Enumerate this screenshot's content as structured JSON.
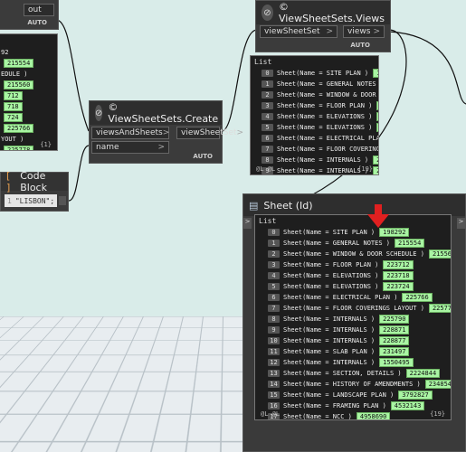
{
  "top_left_node": {
    "out_label": "out",
    "auto_label": "AUTO",
    "list_values": [
      "92",
      "215554",
      "EDULE )",
      "215560",
      "712",
      "718",
      "724",
      "225766",
      "YOUT )",
      "225778",
      "990"
    ],
    "count": "{1}"
  },
  "views_node": {
    "title": "© ViewSheetSets.Views",
    "input": "viewSheetSet",
    "output": "views",
    "auto_label": "AUTO",
    "list_header": "List",
    "count": "{19}",
    "footer_left": "@L @L",
    "rows": [
      {
        "index": "0",
        "text": "Sheet(Name = SITE PLAN )",
        "id": "19829"
      },
      {
        "index": "1",
        "text": "Sheet(Name = GENERAL NOTES )",
        "id": "2"
      },
      {
        "index": "2",
        "text": "Sheet(Name = WINDOW & DOOR SCHEI",
        "id": ""
      },
      {
        "index": "3",
        "text": "Sheet(Name = FLOOR PLAN )",
        "id": "2237"
      },
      {
        "index": "4",
        "text": "Sheet(Name = ELEVATIONS )",
        "id": "2237"
      },
      {
        "index": "5",
        "text": "Sheet(Name = ELEVATIONS )",
        "id": "2237"
      },
      {
        "index": "6",
        "text": "Sheet(Name = ELECTRICAL PLAN )",
        "id": ""
      },
      {
        "index": "7",
        "text": "Sheet(Name = FLOOR COVERINGS LA",
        "id": ""
      },
      {
        "index": "8",
        "text": "Sheet(Name = INTERNALS )",
        "id": "22579"
      },
      {
        "index": "9",
        "text": "Sheet(Name = INTERNALS )",
        "id": "22587"
      }
    ]
  },
  "create_node": {
    "title": "© ViewSheetSets.Create",
    "input1": "viewsAndSheets",
    "input2": "name",
    "output": "viewSheetSet",
    "auto_label": "AUTO"
  },
  "code_block": {
    "title": "Code Block",
    "line_no": "1",
    "code": "\"LISBON\";"
  },
  "sheet_node": {
    "title": "Sheet (Id)",
    "list_header": "List",
    "count": "{19}",
    "footer_left": "@L @L",
    "rows": [
      {
        "index": "0",
        "text": "Sheet(Name = SITE PLAN )",
        "id": "198292"
      },
      {
        "index": "1",
        "text": "Sheet(Name = GENERAL NOTES )",
        "id": "215554"
      },
      {
        "index": "2",
        "text": "Sheet(Name = WINDOW & DOOR SCHEDULE )",
        "id": "215560"
      },
      {
        "index": "3",
        "text": "Sheet(Name = FLOOR PLAN )",
        "id": "223712"
      },
      {
        "index": "4",
        "text": "Sheet(Name = ELEVATIONS )",
        "id": "223718"
      },
      {
        "index": "5",
        "text": "Sheet(Name = ELEVATIONS )",
        "id": "223724"
      },
      {
        "index": "6",
        "text": "Sheet(Name = ELECTRICAL PLAN )",
        "id": "225766"
      },
      {
        "index": "7",
        "text": "Sheet(Name = FLOOR COVERINGS LAYOUT )",
        "id": "225778"
      },
      {
        "index": "8",
        "text": "Sheet(Name = INTERNALS )",
        "id": "225790"
      },
      {
        "index": "9",
        "text": "Sheet(Name = INTERNALS )",
        "id": "228871"
      },
      {
        "index": "10",
        "text": "Sheet(Name = INTERNALS )",
        "id": "228877"
      },
      {
        "index": "11",
        "text": "Sheet(Name = SLAB PLAN )",
        "id": "231497"
      },
      {
        "index": "12",
        "text": "Sheet(Name = INTERNALS )",
        "id": "1550495"
      },
      {
        "index": "13",
        "text": "Sheet(Name = SECTION, DETAILS )",
        "id": "2224844"
      },
      {
        "index": "14",
        "text": "Sheet(Name = HISTORY OF AMENDMENTS )",
        "id": "2348540"
      },
      {
        "index": "15",
        "text": "Sheet(Name = LANDSCAPE PLAN )",
        "id": "3792827"
      },
      {
        "index": "16",
        "text": "Sheet(Name = FRAMING PLAN )",
        "id": "4532143"
      },
      {
        "index": "17",
        "text": "Sheet(Name = NCC )",
        "id": "4958690"
      },
      {
        "index": "18",
        "text": "Sheet(Name = ROOF PLAN )",
        "id": "5098903"
      }
    ]
  },
  "colors": {
    "background": "#d9ece9",
    "node": "#3b3b3b",
    "id_badge": "#a9f5a3",
    "arrow": "#e02020"
  }
}
